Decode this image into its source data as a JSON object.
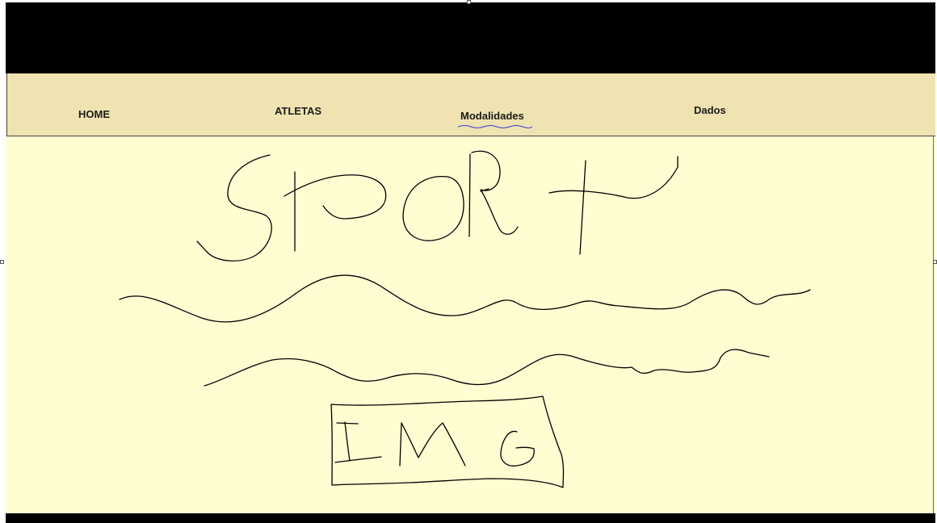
{
  "nav": {
    "items": [
      {
        "label": "HOME"
      },
      {
        "label": "ATLETAS"
      },
      {
        "label": "Modalidades"
      },
      {
        "label": "Dados"
      }
    ]
  },
  "sketch": {
    "title_text": "SPORT",
    "image_placeholder_text": "IMG"
  },
  "colors": {
    "header_bg": "#000000",
    "nav_bg": "#efe3b1",
    "content_bg": "#fffed2",
    "spellcheck_underline": "#3b3bd6"
  }
}
